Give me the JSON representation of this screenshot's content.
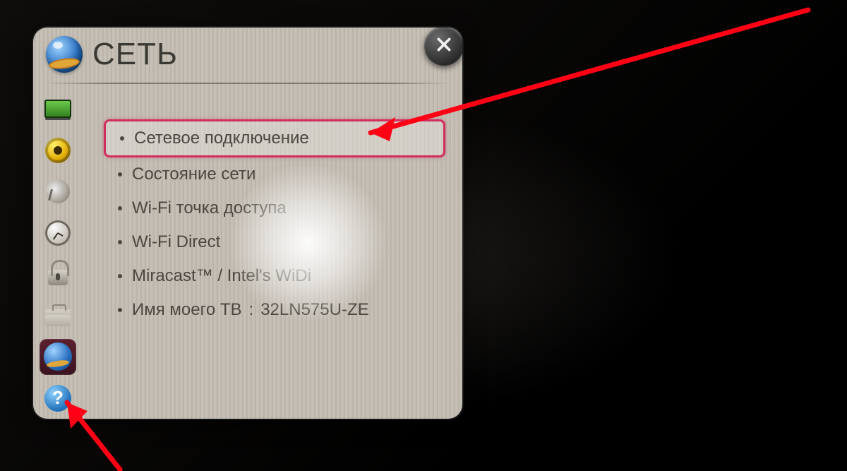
{
  "window": {
    "title": "СЕТЬ"
  },
  "sidebar": {
    "items": [
      {
        "name": "picture",
        "selected": false
      },
      {
        "name": "sound",
        "selected": false
      },
      {
        "name": "channel",
        "selected": false
      },
      {
        "name": "time",
        "selected": false
      },
      {
        "name": "lock",
        "selected": false
      },
      {
        "name": "option",
        "selected": false
      },
      {
        "name": "network",
        "selected": true
      },
      {
        "name": "support",
        "selected": false
      }
    ]
  },
  "menu": {
    "items": [
      {
        "label": "Сетевое подключение",
        "highlighted": true
      },
      {
        "label": "Состояние сети",
        "highlighted": false
      },
      {
        "label": "Wi-Fi точка доступа",
        "highlighted": false
      },
      {
        "label": "Wi-Fi Direct",
        "highlighted": false
      },
      {
        "label": "Miracast™ / Intel's WiDi",
        "highlighted": false
      },
      {
        "label": "Имя моего ТВ",
        "value": "32LN575U-ZE",
        "highlighted": false
      }
    ]
  }
}
